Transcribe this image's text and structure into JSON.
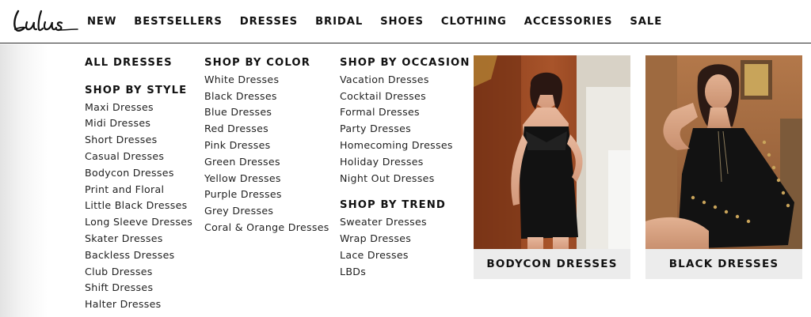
{
  "brand": {
    "logo_text": "Lulus"
  },
  "nav": {
    "items": [
      "NEW",
      "BESTSELLERS",
      "DRESSES",
      "BRIDAL",
      "SHOES",
      "CLOTHING",
      "ACCESSORIES",
      "SALE"
    ]
  },
  "menu": {
    "all_dresses": "ALL DRESSES",
    "by_style": {
      "heading": "SHOP BY STYLE",
      "links": [
        "Maxi Dresses",
        "Midi Dresses",
        "Short Dresses",
        "Casual Dresses",
        "Bodycon Dresses",
        "Print and Floral",
        "Little Black Dresses",
        "Long Sleeve Dresses",
        "Skater Dresses",
        "Backless Dresses",
        "Club Dresses",
        "Shift Dresses",
        "Halter Dresses"
      ]
    },
    "by_color": {
      "heading": "SHOP BY COLOR",
      "links": [
        "White Dresses",
        "Black Dresses",
        "Blue Dresses",
        "Red Dresses",
        "Pink Dresses",
        "Green Dresses",
        "Yellow Dresses",
        "Purple Dresses",
        "Grey Dresses",
        "Coral & Orange Dresses"
      ]
    },
    "by_occasion": {
      "heading": "SHOP BY OCCASION",
      "links": [
        "Vacation Dresses",
        "Cocktail Dresses",
        "Formal Dresses",
        "Party Dresses",
        "Homecoming Dresses",
        "Holiday Dresses",
        "Night Out Dresses"
      ]
    },
    "by_trend": {
      "heading": "SHOP BY TREND",
      "links": [
        "Sweater Dresses",
        "Wrap Dresses",
        "Lace Dresses",
        "LBDs"
      ]
    }
  },
  "promos": [
    {
      "label": "BODYCON DRESSES"
    },
    {
      "label": "BLACK DRESSES"
    }
  ]
}
